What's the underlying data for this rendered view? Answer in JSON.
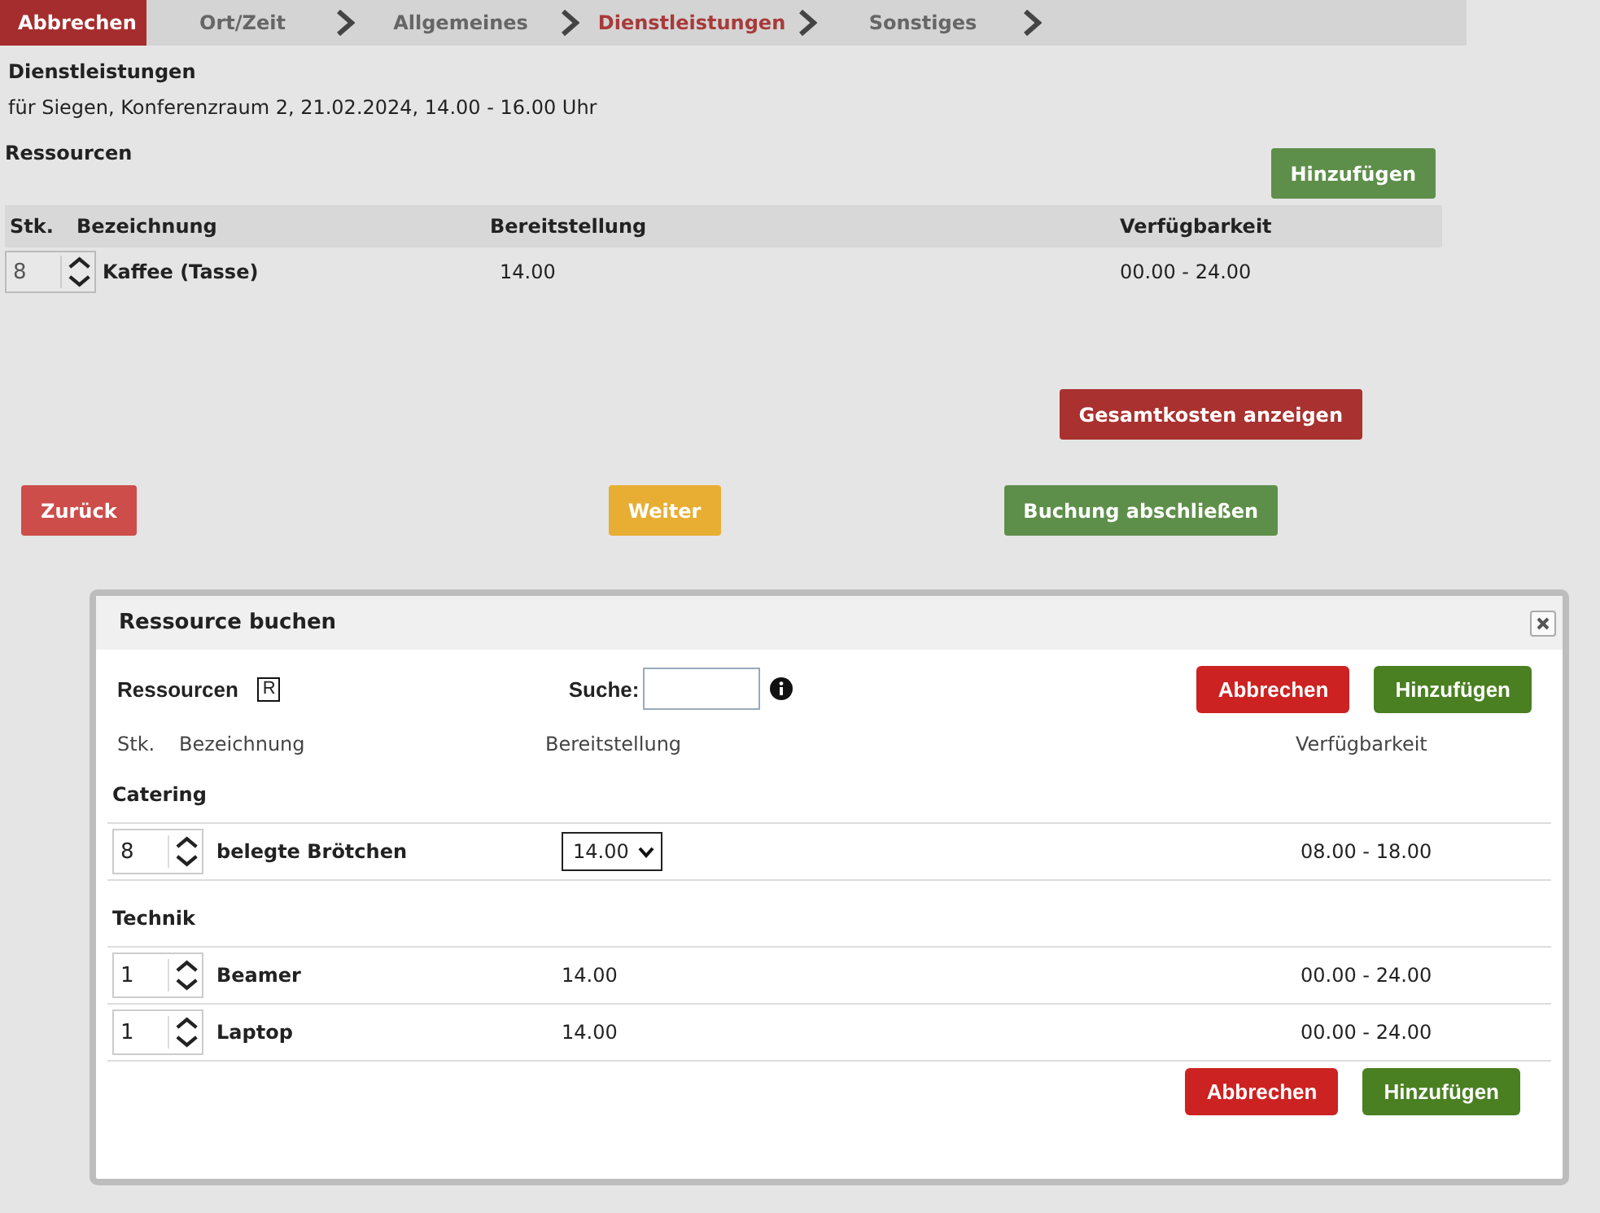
{
  "wizard": {
    "cancel_button": "Abbrechen",
    "steps": [
      {
        "label": "Ort/Zeit",
        "selected": false
      },
      {
        "label": "Allgemeines",
        "selected": false
      },
      {
        "label": "Dienstleistungen",
        "selected": true
      },
      {
        "label": "Sonstiges",
        "selected": false
      }
    ]
  },
  "page": {
    "title": "Dienstleistungen",
    "subtitle": "für Siegen, Konferenzraum 2, 21.02.2024, 14.00 - 16.00 Uhr",
    "section_title": "Ressourcen",
    "add_button": "Hinzufügen",
    "table": {
      "columns": [
        "Stk.",
        "Bezeichnung",
        "Bereitstellung",
        "Verfügbarkeit"
      ],
      "rows": [
        {
          "quantity": "8",
          "name": "Kaffee (Tasse)",
          "provision": "14.00",
          "availability": "00.00 - 24.00"
        }
      ]
    },
    "total_costs_button": "Gesamtkosten anzeigen",
    "nav_buttons": [
      {
        "label": "Zurück",
        "kind": "back"
      },
      {
        "label": "Weiter",
        "kind": "next"
      },
      {
        "label": "Buchung abschließen",
        "kind": "finish"
      }
    ]
  },
  "dialog": {
    "title": "Ressource buchen",
    "resources_label": "Ressourcen",
    "resources_key": "R",
    "search_label": "Suche:",
    "cancel_button": "Abbrechen",
    "add_button": "Hinzufügen",
    "columns": [
      "Stk.",
      "Bezeichnung",
      "Bereitstellung",
      "Verfügbarkeit"
    ],
    "groups": [
      {
        "name": "Catering",
        "items": [
          {
            "quantity": "8",
            "name": "belegte Brötchen",
            "provision": "14.00",
            "kind": "select",
            "availability": "08.00 - 18.00"
          }
        ]
      },
      {
        "name": "Technik",
        "items": [
          {
            "quantity": "1",
            "name": "Beamer",
            "provision": "14.00",
            "kind": "text",
            "availability": "00.00 - 24.00"
          },
          {
            "quantity": "1",
            "name": "Laptop",
            "provision": "14.00",
            "kind": "text",
            "availability": "00.00 - 24.00"
          }
        ]
      }
    ],
    "footer_cancel_button": "Abbrechen",
    "footer_add_button": "Hinzufügen"
  }
}
